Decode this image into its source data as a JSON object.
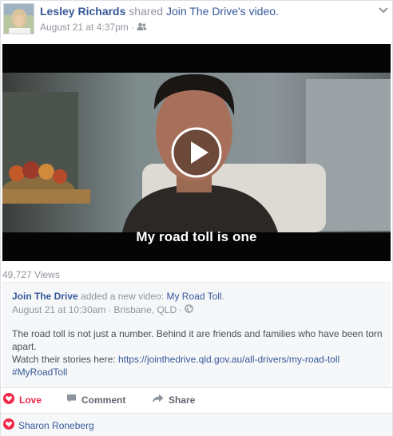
{
  "post": {
    "author": "Lesley Richards",
    "verb": "shared",
    "page": "Join The Drive",
    "object_suffix": "'s video.",
    "timestamp": "August 21 at 4:37pm",
    "dot": "·"
  },
  "video": {
    "caption": "My road toll is one",
    "views": "49,727 Views"
  },
  "shared_post": {
    "author": "Join The Drive",
    "verb": "added a new video:",
    "title": "My Road Toll",
    "title_suffix": ".",
    "timestamp": "August 21 at 10:30am",
    "location": "Brisbane, QLD",
    "dot": "·",
    "body_line1": "The road toll is not just a number. Behind it are friends and families who have been torn apart.",
    "body_line2_prefix": "Watch their stories here:",
    "url": "https://jointhedrive.qld.gov.au/all-drivers/my-road-toll",
    "hashtag": "#MyRoadToll"
  },
  "actions": {
    "love": "Love",
    "comment": "Comment",
    "share": "Share"
  },
  "reactions": {
    "names": "Sharon Roneberg"
  },
  "colors": {
    "link": "#365899",
    "love": "#f0284a",
    "meta": "#90949c"
  }
}
